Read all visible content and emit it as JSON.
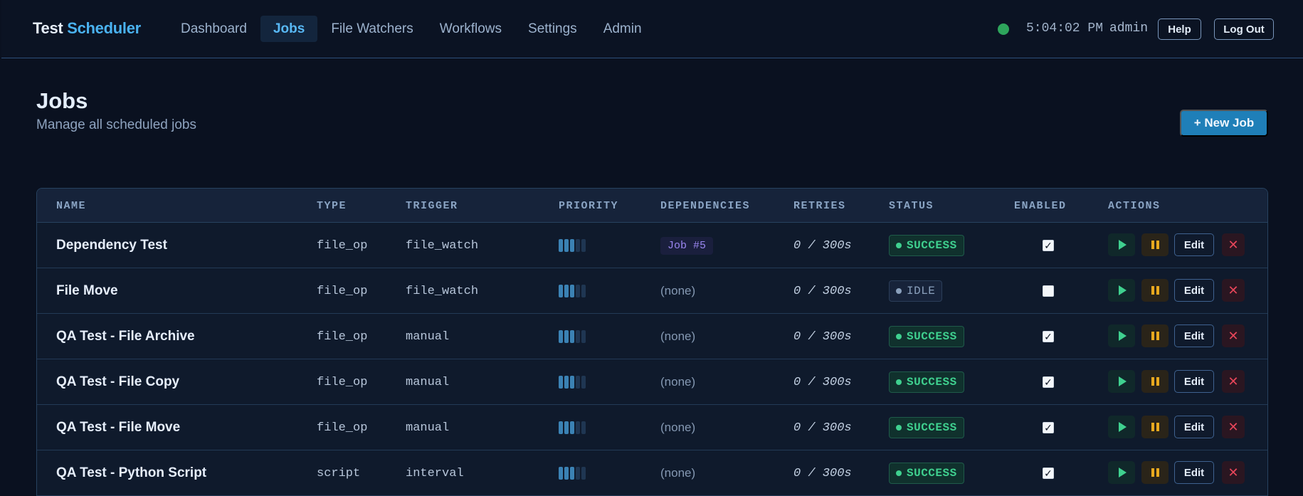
{
  "brand": {
    "part1": "Test",
    "part2": "Scheduler"
  },
  "nav": {
    "items": [
      "Dashboard",
      "Jobs",
      "File Watchers",
      "Workflows",
      "Settings",
      "Admin"
    ],
    "active": "Jobs"
  },
  "header": {
    "clock": "5:04:02 PM",
    "user": "admin",
    "help_label": "Help",
    "logout_label": "Log Out"
  },
  "page": {
    "title": "Jobs",
    "subtitle": "Manage all scheduled jobs",
    "new_job_label": "+ New Job"
  },
  "table": {
    "columns": [
      "NAME",
      "TYPE",
      "TRIGGER",
      "PRIORITY",
      "DEPENDENCIES",
      "RETRIES",
      "STATUS",
      "ENABLED",
      "ACTIONS"
    ],
    "rows": [
      {
        "name": "Dependency Test",
        "type": "file_op",
        "trigger": "file_watch",
        "priority": 3,
        "dependencies": "Job #5",
        "retries": "0 / 300s",
        "status": "SUCCESS",
        "enabled": true
      },
      {
        "name": "File Move",
        "type": "file_op",
        "trigger": "file_watch",
        "priority": 3,
        "dependencies": "(none)",
        "retries": "0 / 300s",
        "status": "IDLE",
        "enabled": false
      },
      {
        "name": "QA Test - File Archive",
        "type": "file_op",
        "trigger": "manual",
        "priority": 3,
        "dependencies": "(none)",
        "retries": "0 / 300s",
        "status": "SUCCESS",
        "enabled": true
      },
      {
        "name": "QA Test - File Copy",
        "type": "file_op",
        "trigger": "manual",
        "priority": 3,
        "dependencies": "(none)",
        "retries": "0 / 300s",
        "status": "SUCCESS",
        "enabled": true
      },
      {
        "name": "QA Test - File Move",
        "type": "file_op",
        "trigger": "manual",
        "priority": 3,
        "dependencies": "(none)",
        "retries": "0 / 300s",
        "status": "SUCCESS",
        "enabled": true
      },
      {
        "name": "QA Test - Python Script",
        "type": "script",
        "trigger": "interval",
        "priority": 3,
        "dependencies": "(none)",
        "retries": "0 / 300s",
        "status": "SUCCESS",
        "enabled": true
      }
    ],
    "priority_max": 5,
    "edit_label": "Edit"
  },
  "colors": {
    "accent": "#4ab2f0",
    "success": "#3fd08f",
    "danger": "#e8465a",
    "pause": "#e9a91f",
    "online": "#2ea55c"
  },
  "icons": {
    "run": "play-icon",
    "pause": "pause-icon",
    "delete": "close-icon",
    "status": "status-dot-icon"
  }
}
